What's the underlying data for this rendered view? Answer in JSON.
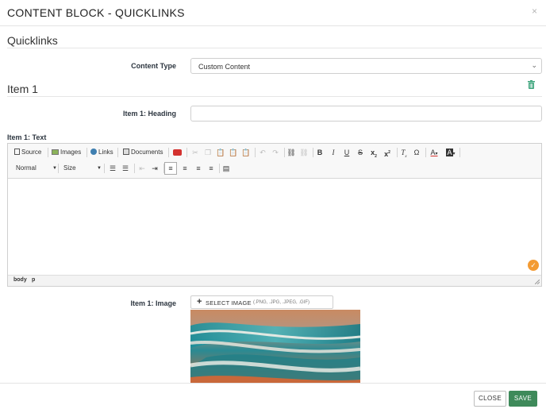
{
  "modal": {
    "title": "CONTENT BLOCK - QUICKLINKS",
    "close_glyph": "×"
  },
  "section": {
    "title": "Quicklinks"
  },
  "content_type": {
    "label": "Content Type",
    "value": "Custom Content"
  },
  "item": {
    "title": "Item 1",
    "heading_label": "Item 1: Heading",
    "heading_value": "",
    "text_label": "Item 1: Text",
    "image_label": "Item 1: Image"
  },
  "toolbar": {
    "source": "Source",
    "images": "Images",
    "links": "Links",
    "documents": "Documents",
    "format": "Normal",
    "size": "Size",
    "bold": "B",
    "italic": "I",
    "underline": "U",
    "strike": "S",
    "subscript": "x",
    "superscript": "x",
    "clear_format": "T",
    "omega": "Ω",
    "text_color": "A",
    "bg_color": "A"
  },
  "statusbar": {
    "path": [
      "body",
      "p"
    ]
  },
  "select_image": {
    "label": "SELECT IMAGE",
    "formats": "(.PNG, .JPG, .JPEG, .GIF)"
  },
  "footer": {
    "close": "CLOSE",
    "save": "SAVE"
  },
  "colors": {
    "save": "#3e8a5a",
    "check": "#f39b33",
    "trash": "#3aa37a",
    "youtube": "#d3322f"
  }
}
